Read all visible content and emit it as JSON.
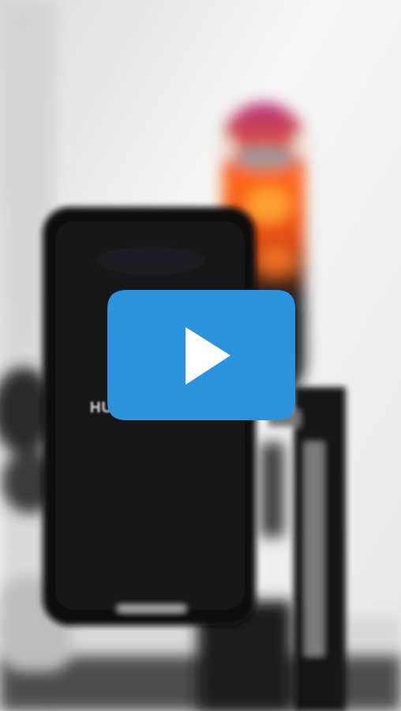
{
  "video": {
    "brand_text": "HUMMINGBIRD",
    "play_icon": "play-button-icon",
    "colors": {
      "play_bg": "#2b93dc",
      "play_arrow": "#ffffff"
    }
  }
}
